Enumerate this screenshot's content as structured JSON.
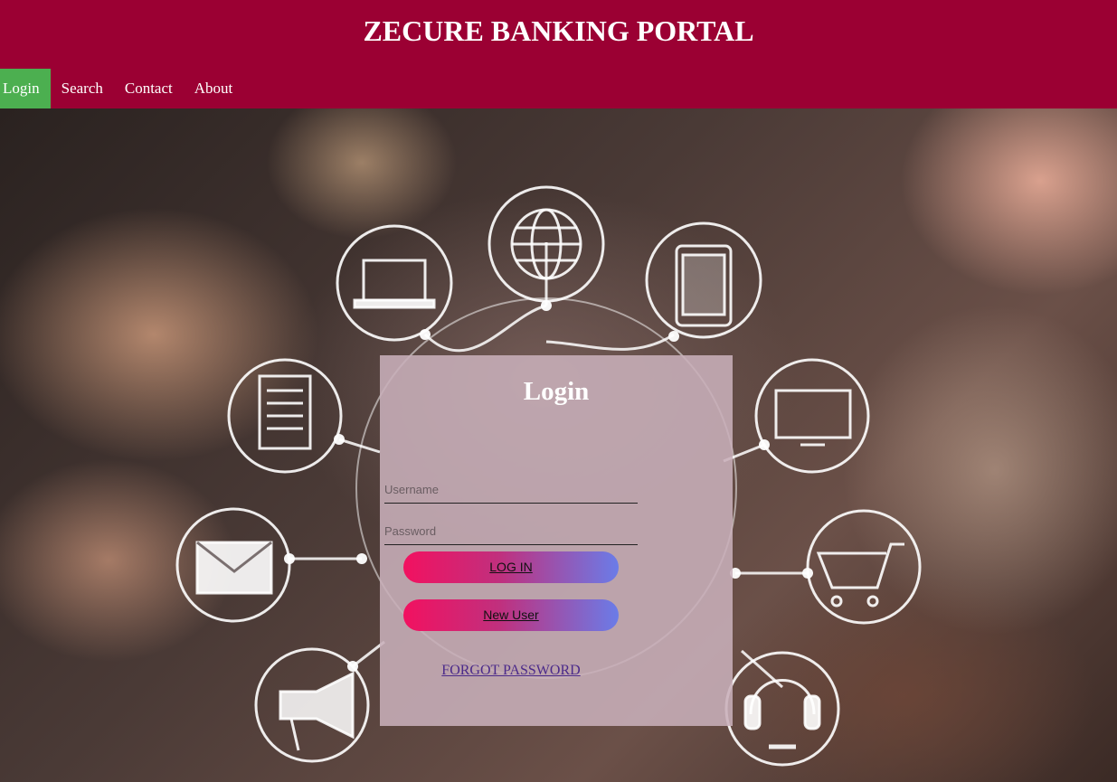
{
  "site": {
    "title": "ZECURE BANKING PORTAL"
  },
  "nav": {
    "items": [
      {
        "label": "Login",
        "active": true
      },
      {
        "label": "Search"
      },
      {
        "label": "Contact"
      },
      {
        "label": "About"
      }
    ],
    "active_color": "#4caf50"
  },
  "theme": {
    "header_color": "#9b0033"
  },
  "hero": {
    "icons": [
      "laptop-icon",
      "globe-icon",
      "tablet-icon",
      "document-icon",
      "monitor-icon",
      "envelope-icon",
      "shopping-cart-icon",
      "megaphone-icon",
      "headset-icon"
    ]
  },
  "login": {
    "title": "Login",
    "username_placeholder": "Username",
    "password_placeholder": "Password",
    "login_button": "LOG IN",
    "new_user_button": "New User",
    "forgot_link": "FORGOT PASSWORD"
  }
}
